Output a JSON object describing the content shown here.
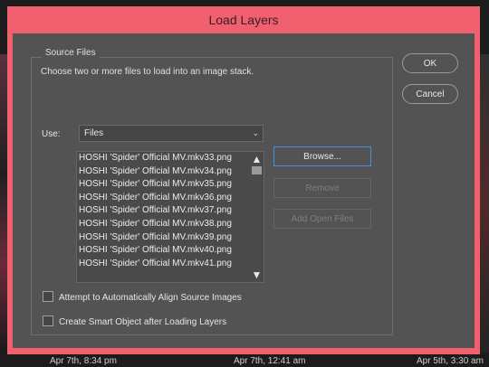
{
  "dialog": {
    "title": "Load Layers",
    "source_group_title": "Source Files",
    "description": "Choose two or more files to load into an image stack.",
    "use_label": "Use:",
    "use_value": "Files",
    "files": [
      "HOSHI 'Spider' Official MV.mkv33.png",
      "HOSHI 'Spider' Official MV.mkv34.png",
      "HOSHI 'Spider' Official MV.mkv35.png",
      "HOSHI 'Spider' Official MV.mkv36.png",
      "HOSHI 'Spider' Official MV.mkv37.png",
      "HOSHI 'Spider' Official MV.mkv38.png",
      "HOSHI 'Spider' Official MV.mkv39.png",
      "HOSHI 'Spider' Official MV.mkv40.png",
      "HOSHI 'Spider' Official MV.mkv41.png"
    ],
    "buttons": {
      "browse": "Browse...",
      "remove": "Remove",
      "add_open_files": "Add Open Files",
      "ok": "OK",
      "cancel": "Cancel"
    },
    "checkboxes": {
      "align": "Attempt to Automatically Align Source Images",
      "smart_object": "Create Smart Object after Loading Layers"
    }
  },
  "background": {
    "captions": [
      "Apr 7th, 8:34 pm",
      "Apr 7th, 12:41 am",
      "Apr 5th, 3:30 am"
    ]
  },
  "colors": {
    "titlebar": "#f0606e",
    "panel": "#535353",
    "primary_border": "#4a8ee0"
  }
}
